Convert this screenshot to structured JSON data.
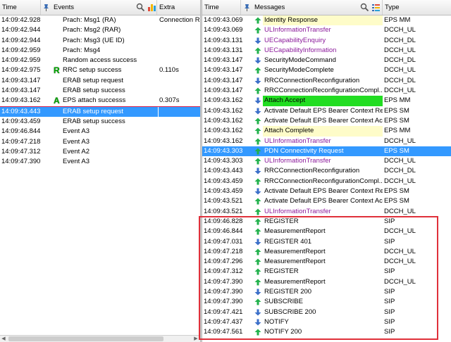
{
  "left": {
    "headers": {
      "time": "Time",
      "events": "Events",
      "extra": "Extra"
    },
    "rows": [
      {
        "time": "14:09:42.928",
        "event": "Prach: Msg1 (RA)",
        "extra": "Connection Re",
        "badge": ""
      },
      {
        "time": "14:09:42.944",
        "event": "Prach: Msg2 (RAR)",
        "extra": "",
        "badge": ""
      },
      {
        "time": "14:09:42.944",
        "event": "Prach: Msg3 (UE ID)",
        "extra": "",
        "badge": ""
      },
      {
        "time": "14:09:42.959",
        "event": "Prach: Msg4",
        "extra": "",
        "badge": ""
      },
      {
        "time": "14:09:42.959",
        "event": "Random access success",
        "extra": "",
        "badge": ""
      },
      {
        "time": "14:09:42.975",
        "event": "RRC setup success",
        "extra": "0.110s",
        "badge": "R"
      },
      {
        "time": "14:09:43.147",
        "event": "ERAB setup request",
        "extra": "",
        "badge": ""
      },
      {
        "time": "14:09:43.147",
        "event": "ERAB setup success",
        "extra": "",
        "badge": ""
      },
      {
        "time": "14:09:43.162",
        "event": "EPS attach successs",
        "extra": "0.307s",
        "badge": "A"
      },
      {
        "time": "14:09:43.443",
        "event": "ERAB setup request",
        "extra": "",
        "badge": "",
        "selected": true
      },
      {
        "time": "14:09:43.459",
        "event": "ERAB setup success",
        "extra": "",
        "badge": ""
      },
      {
        "time": "14:09:46.844",
        "event": "Event A3",
        "extra": "",
        "badge": ""
      },
      {
        "time": "14:09:47.218",
        "event": "Event A3",
        "extra": "",
        "badge": ""
      },
      {
        "time": "14:09:47.312",
        "event": "Event A2",
        "extra": "",
        "badge": ""
      },
      {
        "time": "14:09:47.390",
        "event": "Event A3",
        "extra": "",
        "badge": ""
      }
    ]
  },
  "right": {
    "headers": {
      "time": "Time",
      "messages": "Messages",
      "type": "Type"
    },
    "rows": [
      {
        "time": "14:09:43.069",
        "msg": "Identity Response",
        "type": "EPS MM",
        "dir": "up",
        "style": "yellow"
      },
      {
        "time": "14:09:43.069",
        "msg": "ULInformationTransfer",
        "type": "DCCH_UL",
        "dir": "up",
        "style": "purple"
      },
      {
        "time": "14:09:43.131",
        "msg": "UECapabilityEnquiry",
        "type": "DCCH_DL",
        "dir": "down",
        "style": "purple"
      },
      {
        "time": "14:09:43.131",
        "msg": "UECapabilityInformation",
        "type": "DCCH_UL",
        "dir": "up",
        "style": "purple"
      },
      {
        "time": "14:09:43.147",
        "msg": "SecurityModeCommand",
        "type": "DCCH_DL",
        "dir": "down",
        "style": ""
      },
      {
        "time": "14:09:43.147",
        "msg": "SecurityModeComplete",
        "type": "DCCH_UL",
        "dir": "up",
        "style": ""
      },
      {
        "time": "14:09:43.147",
        "msg": "RRCConnectionReconfiguration",
        "type": "DCCH_DL",
        "dir": "down",
        "style": ""
      },
      {
        "time": "14:09:43.147",
        "msg": "RRCConnectionReconfigurationCompl...",
        "type": "DCCH_UL",
        "dir": "up",
        "style": ""
      },
      {
        "time": "14:09:43.162",
        "msg": "Attach Accept",
        "type": "EPS MM",
        "dir": "down",
        "style": "green"
      },
      {
        "time": "14:09:43.162",
        "msg": "Activate Default EPS Bearer Context Re...",
        "type": "EPS SM",
        "dir": "down",
        "style": ""
      },
      {
        "time": "14:09:43.162",
        "msg": "Activate Default EPS Bearer Context Acc...",
        "type": "EPS SM",
        "dir": "up",
        "style": ""
      },
      {
        "time": "14:09:43.162",
        "msg": "Attach Complete",
        "type": "EPS MM",
        "dir": "up",
        "style": "yellow"
      },
      {
        "time": "14:09:43.162",
        "msg": "ULInformationTransfer",
        "type": "DCCH_UL",
        "dir": "up",
        "style": "purple"
      },
      {
        "time": "14:09:43.303",
        "msg": "PDN Connectivity Request",
        "type": "EPS SM",
        "dir": "up",
        "style": "selected"
      },
      {
        "time": "14:09:43.303",
        "msg": "ULInformationTransfer",
        "type": "DCCH_UL",
        "dir": "up",
        "style": "purple"
      },
      {
        "time": "14:09:43.443",
        "msg": "RRCConnectionReconfiguration",
        "type": "DCCH_DL",
        "dir": "down",
        "style": ""
      },
      {
        "time": "14:09:43.459",
        "msg": "RRCConnectionReconfigurationCompl...",
        "type": "DCCH_UL",
        "dir": "up",
        "style": ""
      },
      {
        "time": "14:09:43.459",
        "msg": "Activate Default EPS Bearer Context Re...",
        "type": "EPS SM",
        "dir": "down",
        "style": ""
      },
      {
        "time": "14:09:43.521",
        "msg": "Activate Default EPS Bearer Context Acc...",
        "type": "EPS SM",
        "dir": "up",
        "style": ""
      },
      {
        "time": "14:09:43.521",
        "msg": "ULInformationTransfer",
        "type": "DCCH_UL",
        "dir": "up",
        "style": "purple"
      },
      {
        "time": "14:09:46.828",
        "msg": "REGISTER",
        "type": "SIP",
        "dir": "up",
        "style": ""
      },
      {
        "time": "14:09:46.844",
        "msg": "MeasurementReport",
        "type": "DCCH_UL",
        "dir": "up",
        "style": ""
      },
      {
        "time": "14:09:47.031",
        "msg": "REGISTER 401",
        "type": "SIP",
        "dir": "down",
        "style": ""
      },
      {
        "time": "14:09:47.218",
        "msg": "MeasurementReport",
        "type": "DCCH_UL",
        "dir": "up",
        "style": ""
      },
      {
        "time": "14:09:47.296",
        "msg": "MeasurementReport",
        "type": "DCCH_UL",
        "dir": "up",
        "style": ""
      },
      {
        "time": "14:09:47.312",
        "msg": "REGISTER",
        "type": "SIP",
        "dir": "up",
        "style": ""
      },
      {
        "time": "14:09:47.390",
        "msg": "MeasurementReport",
        "type": "DCCH_UL",
        "dir": "up",
        "style": ""
      },
      {
        "time": "14:09:47.390",
        "msg": "REGISTER 200",
        "type": "SIP",
        "dir": "down",
        "style": ""
      },
      {
        "time": "14:09:47.390",
        "msg": "SUBSCRIBE",
        "type": "SIP",
        "dir": "up",
        "style": ""
      },
      {
        "time": "14:09:47.421",
        "msg": "SUBSCRIBE 200",
        "type": "SIP",
        "dir": "down",
        "style": ""
      },
      {
        "time": "14:09:47.437",
        "msg": "NOTIFY",
        "type": "SIP",
        "dir": "down",
        "style": ""
      },
      {
        "time": "14:09:47.561",
        "msg": "NOTIFY 200",
        "type": "SIP",
        "dir": "up",
        "style": ""
      }
    ]
  },
  "icons": {
    "pin": "pin-icon",
    "search": "search-icon",
    "chart": "bar-chart-icon",
    "columns": "columns-icon",
    "up": "uplink-arrow-icon",
    "down": "downlink-arrow-icon"
  },
  "colors": {
    "selection": "#3399ff",
    "uplink": "#22b14c",
    "downlink": "#3b6fc9",
    "purple_text": "#8b1a9b",
    "yellow_bg": "#fefcc9",
    "green_bg": "#22dd22",
    "highlight_box": "#e0303a"
  }
}
